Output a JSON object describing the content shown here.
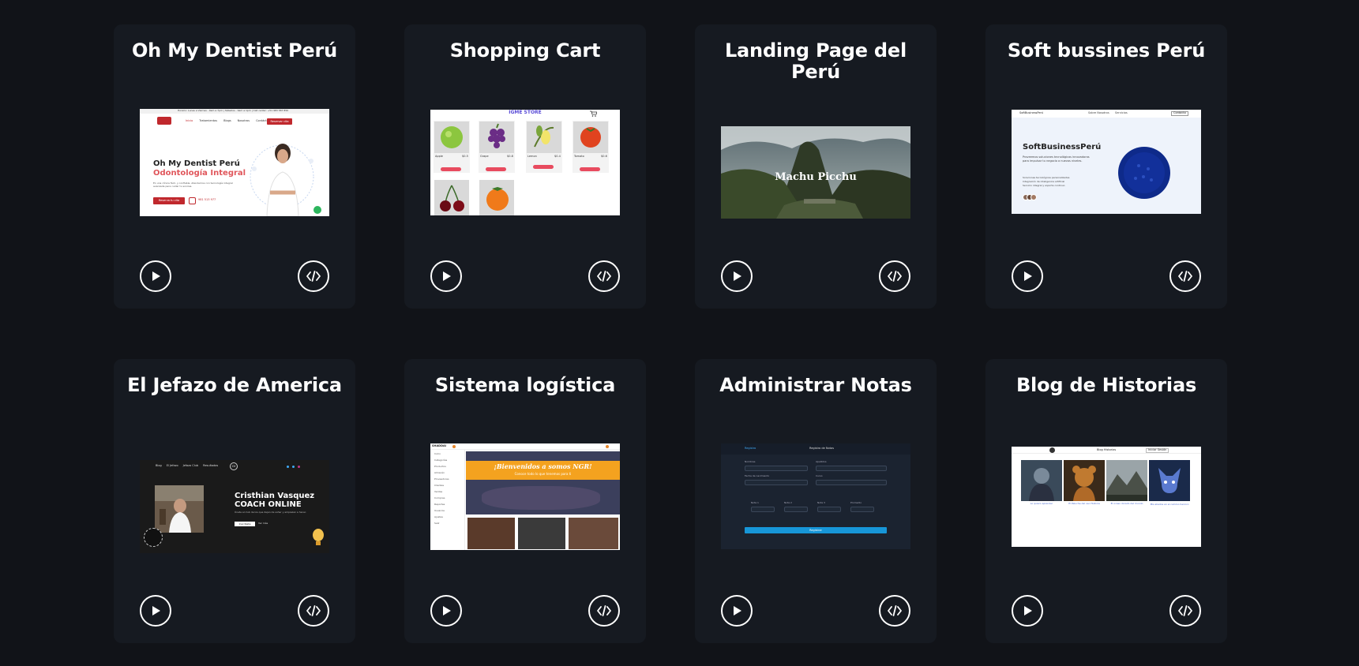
{
  "projects": [
    {
      "title": "Oh My Dentist Perú",
      "preview": {
        "topbar": "Horario: Lunes a Viernes - 9am a 7pm | Sábados - 9am a 1pm | Call center: +51 983 587 850",
        "nav": [
          "Inicio",
          "Tratamientos",
          "Blogs",
          "Nosotros",
          "Contáctenos"
        ],
        "cta": "Reservar cita",
        "heading": "Oh My Dentist Perú",
        "subheading": "Odontología Integral",
        "body": "En una clínica fácil, y confiable. Atendemos con tecnología integral avanzada para cuidar tu sonrisa.",
        "button": "Reserva tu cita",
        "phone": "981 513 977"
      }
    },
    {
      "title": "Shopping Cart",
      "preview": {
        "store_name": "IGME STORE",
        "items": [
          {
            "name": "Apple",
            "price": "$0.5",
            "button": "Add to Cart"
          },
          {
            "name": "Grape",
            "price": "$0.8",
            "button": "Add to Cart"
          },
          {
            "name": "Lemon",
            "price": "$0.4",
            "button": "Add to Cart"
          },
          {
            "name": "Tomato",
            "price": "$0.6",
            "button": "Add to Cart"
          }
        ]
      }
    },
    {
      "title": "Landing Page del Perú",
      "preview": {
        "hero_text": "Machu Picchu"
      }
    },
    {
      "title": "Soft bussines Perú",
      "preview": {
        "brand": "SoftBusinessPerú",
        "nav": [
          "Sobre Nosotros",
          "Servicios"
        ],
        "nav_button": "Contacto",
        "heading": "SoftBusinessPerú",
        "body": "Proveemos soluciones tecnológicas innovadoras para impulsar tu negocio a nuevos niveles.",
        "bullets": [
          "Soluciones tecnológicas personalizadas",
          "Integración de inteligencia artificial",
          "Servicio integral y soporte continuo"
        ]
      }
    },
    {
      "title": "El Jefazo de America",
      "preview": {
        "nav": [
          "Blog",
          "El Jefazo",
          "Jefazo Club",
          "Resultados"
        ],
        "logo": "CV",
        "heading1": "Cristhian Vasquez",
        "heading2": "COACH ONLINE",
        "body": "Únete al club de los que dejan de soñar y empiezan a hacer.",
        "button1": "Inscríbete",
        "button2": "Ver más"
      }
    },
    {
      "title": "Sistema logística",
      "preview": {
        "brand": "SHADDAI",
        "banner_title": "¡Bienvenidos a somos NGR!",
        "banner_sub": "Conoce todo lo que tenemos para ti",
        "sidebar": [
          "Inicio",
          "Categorías",
          "Productos",
          "Almacén",
          "Proveedores",
          "Clientes",
          "Ventas",
          "Compras",
          "Reportes",
          "Usuarios",
          "Ajustes",
          "Salir"
        ]
      }
    },
    {
      "title": "Administrar Notas",
      "preview": {
        "tab": "Registro",
        "header": "Registro de Notas",
        "labels": [
          "Nombres",
          "Apellidos",
          "Fecha de nacimiento",
          "Curso",
          "Nota 1",
          "Nota 2",
          "Nota 3",
          "Promedio"
        ],
        "button": "Registrar"
      }
    },
    {
      "title": "Blog de Historias",
      "preview": {
        "nav": [
          "Blog Historias",
          "Iniciar Sesión"
        ],
        "captions": [
          "Lo quiero aprender",
          "El Peluche del oso Historia",
          "El ocaso dorado del mundo",
          "Mis aliados en el camino heroico"
        ]
      }
    }
  ],
  "actions": {
    "play_icon": "play-icon",
    "code_icon": "code-icon"
  }
}
